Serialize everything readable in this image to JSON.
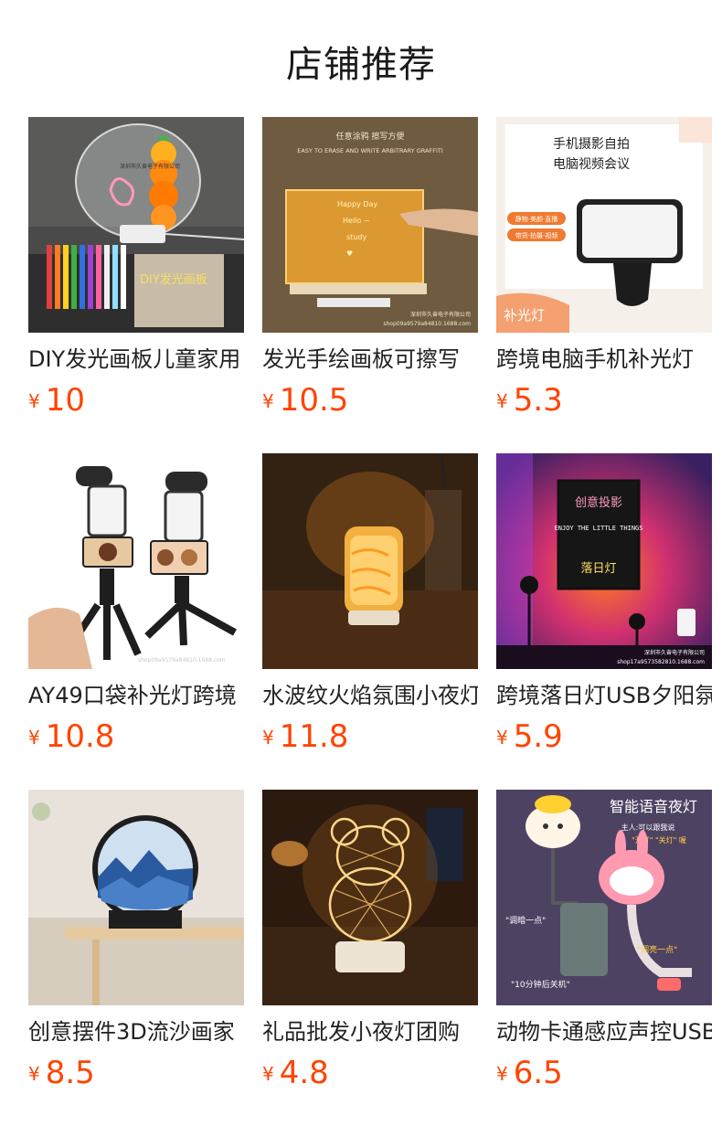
{
  "section": {
    "title": "店铺推荐"
  },
  "products": [
    {
      "name": "DIY发光画板儿童家用",
      "currency": "¥",
      "price": "10",
      "image": "acrylic-led-drawing-board",
      "overlay_text": [
        "DIY发光画板",
        "深圳市久奋电子有限公司"
      ]
    },
    {
      "name": "发光手绘画板可擦写",
      "currency": "¥",
      "price": "10.5",
      "image": "led-writing-board",
      "overlay_text": [
        "任意涂鸦 擦写方便",
        "EASY TO ERASE AND WRITE ARBITRARY GRAFFITI",
        "深圳市久奋电子有限公司",
        "shop09a9579a84810.1688.com"
      ]
    },
    {
      "name": "跨境电脑手机补光灯",
      "currency": "¥",
      "price": "5.3",
      "image": "clip-fill-light",
      "overlay_text": [
        "手机摄影自拍",
        "电脑视频会议",
        "静物·美颜·直播",
        "带货·拍摄·视频",
        "补光灯"
      ]
    },
    {
      "name": "AY49口袋补光灯跨境",
      "currency": "¥",
      "price": "10.8",
      "image": "vlog-tripod-kit",
      "overlay_text": []
    },
    {
      "name": "水波纹火焰氛围小夜灯",
      "currency": "¥",
      "price": "11.8",
      "image": "water-ripple-lamp",
      "overlay_text": []
    },
    {
      "name": "跨境落日灯USB夕阳氛",
      "currency": "¥",
      "price": "5.9",
      "image": "sunset-projection-lamp",
      "overlay_text": [
        "创意投影",
        "ENJOY THE LITTLE THINGS",
        "落日灯",
        "深圳市久奋电子有限公司"
      ]
    },
    {
      "name": "创意摆件3D流沙画家",
      "currency": "¥",
      "price": "8.5",
      "image": "sand-art-frame",
      "overlay_text": []
    },
    {
      "name": "礼品批发小夜灯团购",
      "currency": "¥",
      "price": "4.8",
      "image": "bear-3d-night-light",
      "overlay_text": []
    },
    {
      "name": "动物卡通感应声控USB",
      "currency": "¥",
      "price": "6.5",
      "image": "voice-animal-night-light",
      "overlay_text": [
        "智能语音夜灯",
        "主人:可以跟我说",
        "\"开灯\" \"关灯\" 喔",
        "\"调暗一点\"",
        "\"调亮一点\"",
        "\"10分钟后关机\""
      ]
    }
  ]
}
